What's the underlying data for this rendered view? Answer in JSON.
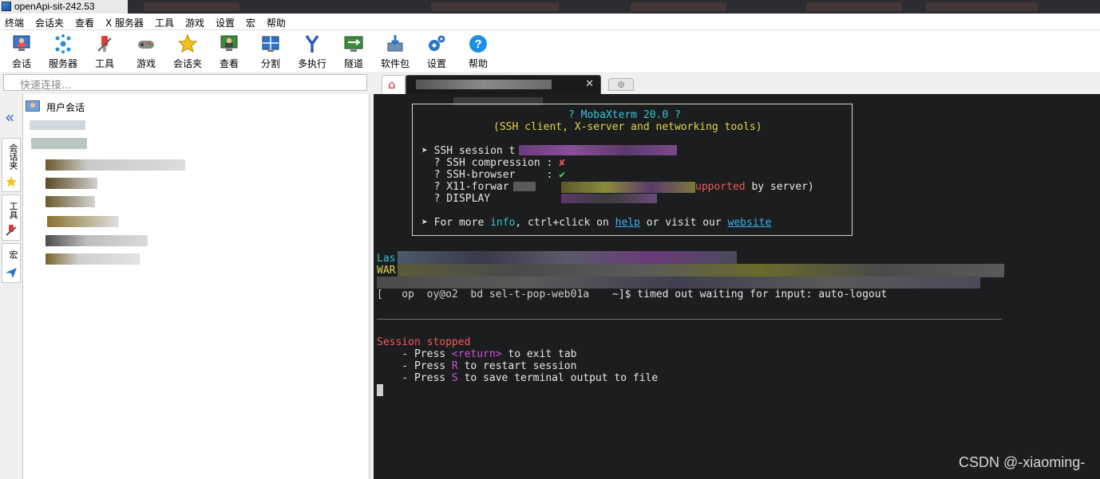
{
  "window": {
    "title": "openApi-sit-242.53"
  },
  "menu": [
    "终端",
    "会话夹",
    "查看",
    "X 服务器",
    "工具",
    "游戏",
    "设置",
    "宏",
    "帮助"
  ],
  "toolbar": [
    {
      "label": "会话",
      "icon": "session-icon"
    },
    {
      "label": "服务器",
      "icon": "servers-icon"
    },
    {
      "label": "工具",
      "icon": "tools-icon"
    },
    {
      "label": "游戏",
      "icon": "games-icon"
    },
    {
      "label": "会话夹",
      "icon": "star-icon"
    },
    {
      "label": "查看",
      "icon": "view-icon"
    },
    {
      "label": "分割",
      "icon": "split-icon"
    },
    {
      "label": "多执行",
      "icon": "multiexec-icon"
    },
    {
      "label": "隧道",
      "icon": "tunnel-icon"
    },
    {
      "label": "软件包",
      "icon": "packages-icon"
    },
    {
      "label": "设置",
      "icon": "settings-icon"
    },
    {
      "label": "帮助",
      "icon": "help-icon"
    }
  ],
  "quick_connect": {
    "placeholder": "快速连接..."
  },
  "side_tabs": [
    "会话夹",
    "工具",
    "宏"
  ],
  "tree": {
    "root_label": "用户会话"
  },
  "terminal": {
    "banner_title": "? MobaXterm 20.0 ?",
    "banner_subtitle": "(SSH client, X-server and networking tools)",
    "ssh_session": "➤ SSH session t",
    "ssh_compression_label": "  ? SSH compression : ",
    "ssh_compression_mark": "✘",
    "ssh_browser_label": "  ? SSH-browser     : ",
    "ssh_browser_mark": "✔",
    "x11_prefix": "  ? X11-forwar",
    "x11_red": "upported",
    "x11_suffix": " by server)",
    "display_label": "  ? DISPLAY",
    "more_prefix": "➤ For more ",
    "more_info": "info",
    "more_mid": ", ctrl+click on ",
    "more_help": "help",
    "more_or": " or visit our ",
    "more_website": "website",
    "last_prefix": "Las",
    "warn_prefix": "WAR",
    "prompt_tail": "~]$ timed out waiting for input: auto-logout",
    "prompt_partial": "[   op  oy@o2  bd sel-t-pop-web01a",
    "session_stopped": "Session stopped",
    "press1_pre": "    - Press ",
    "press1_key": "<return>",
    "press1_post": " to exit tab",
    "press2_pre": "    - Press ",
    "press2_key": "R",
    "press2_post": " to restart session",
    "press3_pre": "    - Press ",
    "press3_key": "S",
    "press3_post": " to save terminal output to file"
  },
  "watermark": "CSDN @-xiaoming-"
}
